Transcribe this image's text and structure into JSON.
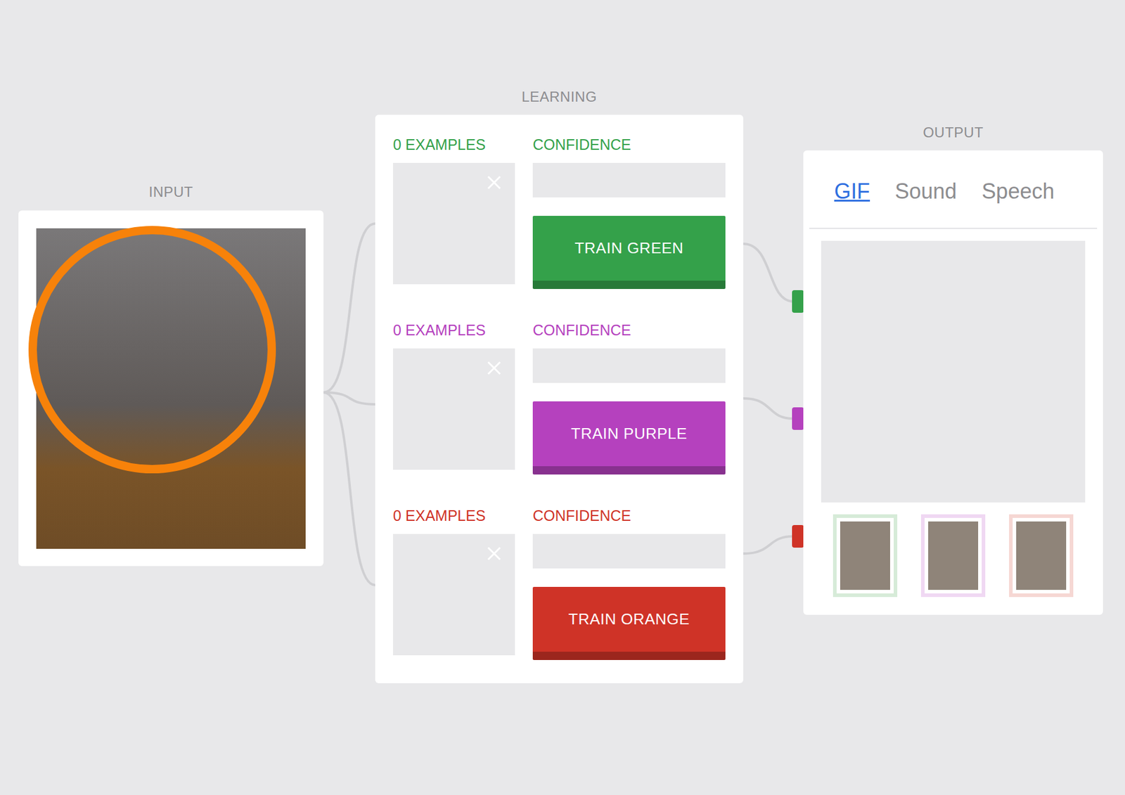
{
  "input": {
    "label": "INPUT"
  },
  "learning": {
    "label": "LEARNING",
    "classes": [
      {
        "examples": "0 EXAMPLES",
        "confidence_label": "CONFIDENCE",
        "confidence": 0,
        "button": "TRAIN GREEN",
        "color": "#34a14a"
      },
      {
        "examples": "0 EXAMPLES",
        "confidence_label": "CONFIDENCE",
        "confidence": 0,
        "button": "TRAIN PURPLE",
        "color": "#b541be"
      },
      {
        "examples": "0 EXAMPLES",
        "confidence_label": "CONFIDENCE",
        "confidence": 0,
        "button": "TRAIN ORANGE",
        "color": "#cf3327"
      }
    ]
  },
  "output": {
    "label": "OUTPUT",
    "tabs": [
      {
        "label": "GIF",
        "selected": true
      },
      {
        "label": "Sound",
        "selected": false
      },
      {
        "label": "Speech",
        "selected": false
      }
    ],
    "thumbnails": [
      {
        "color": "#d6ebd8"
      },
      {
        "color": "#f0d8f3"
      },
      {
        "color": "#f6d7d3"
      }
    ]
  }
}
